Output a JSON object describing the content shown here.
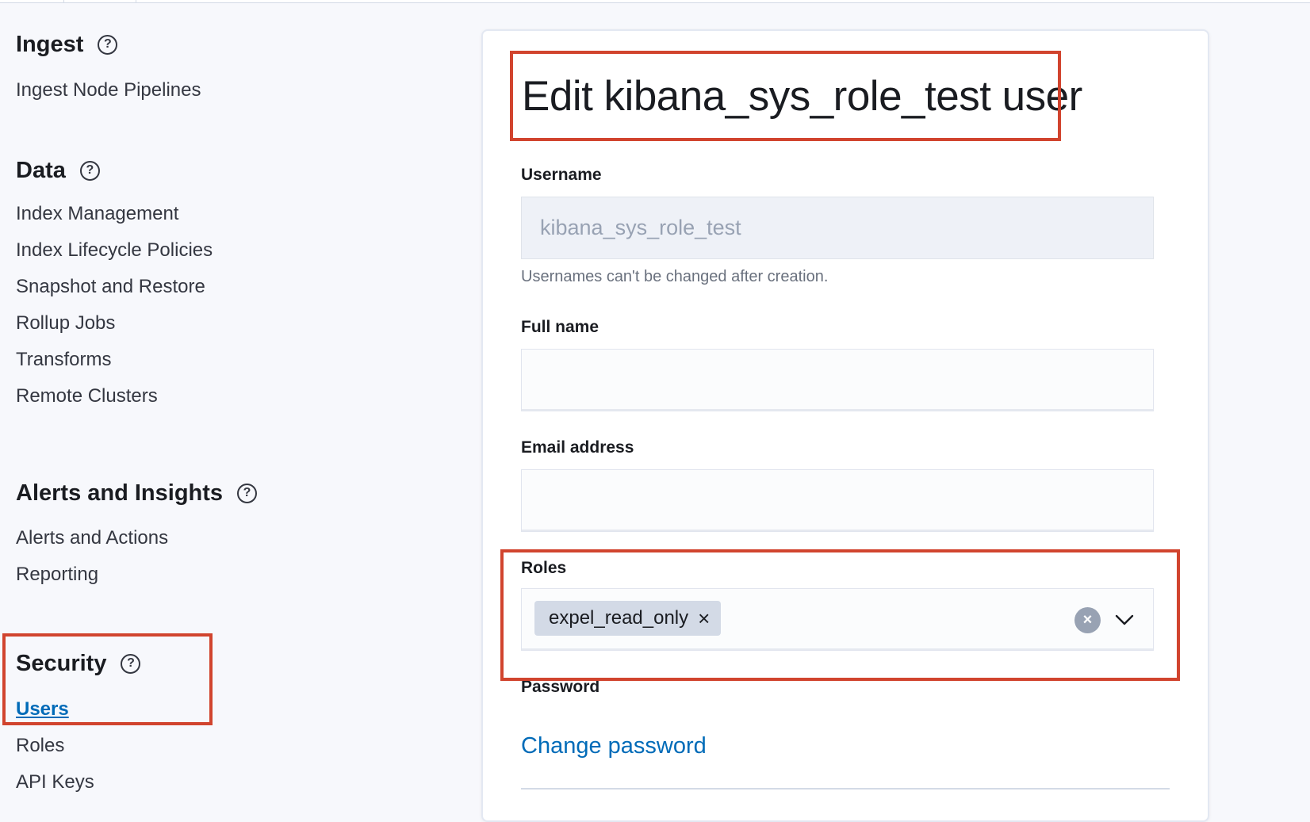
{
  "sidebar": {
    "sections": [
      {
        "title": "Ingest",
        "items": [
          {
            "label": "Ingest Node Pipelines"
          }
        ]
      },
      {
        "title": "Data",
        "items": [
          {
            "label": "Index Management"
          },
          {
            "label": "Index Lifecycle Policies"
          },
          {
            "label": "Snapshot and Restore"
          },
          {
            "label": "Rollup Jobs"
          },
          {
            "label": "Transforms"
          },
          {
            "label": "Remote Clusters"
          }
        ]
      },
      {
        "title": "Alerts and Insights",
        "items": [
          {
            "label": "Alerts and Actions"
          },
          {
            "label": "Reporting"
          }
        ]
      },
      {
        "title": "Security",
        "items": [
          {
            "label": "Users",
            "active": true
          },
          {
            "label": "Roles"
          },
          {
            "label": "API Keys"
          }
        ]
      }
    ],
    "help_glyph": "?"
  },
  "form": {
    "title": "Edit kibana_sys_role_test user",
    "username": {
      "label": "Username",
      "value": "kibana_sys_role_test",
      "help": "Usernames can't be changed after creation."
    },
    "full_name": {
      "label": "Full name",
      "value": ""
    },
    "email": {
      "label": "Email address",
      "value": ""
    },
    "roles": {
      "label": "Roles",
      "selected": [
        "expel_read_only"
      ],
      "remove_glyph": "×",
      "clear_glyph": "×"
    },
    "password": {
      "label": "Password",
      "change_link": "Change password"
    }
  },
  "icons": {
    "help": "help-circle-icon",
    "clear": "clear-circle-icon",
    "chevron": "chevron-down-icon",
    "remove": "close-icon"
  },
  "colors": {
    "annotation": "#d1442e",
    "link": "#006bb8",
    "pill": "#d3dae6"
  }
}
